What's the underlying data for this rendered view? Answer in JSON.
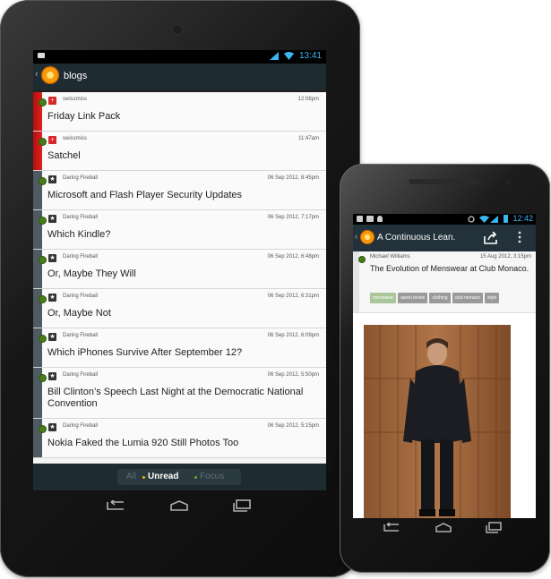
{
  "tablet": {
    "status": {
      "time": "13:41"
    },
    "header": {
      "title": "blogs",
      "back_glyph": "‹"
    },
    "stories": [
      {
        "feed": "swissmiss",
        "date": "12:08pm",
        "title": "Friday Link Pack",
        "feed_icon": "swiss-cross-icon"
      },
      {
        "feed": "swissmiss",
        "date": "11:47am",
        "title": "Satchel",
        "feed_icon": "swiss-cross-icon"
      },
      {
        "feed": "Daring Fireball",
        "date": "06 Sep 2012, 8:45pm",
        "title": "Microsoft and Flash Player Security Updates",
        "feed_icon": "star-icon"
      },
      {
        "feed": "Daring Fireball",
        "date": "06 Sep 2012, 7:17pm",
        "title": "Which Kindle?",
        "feed_icon": "star-icon"
      },
      {
        "feed": "Daring Fireball",
        "date": "06 Sep 2012, 6:48pm",
        "title": "Or, Maybe They Will",
        "feed_icon": "star-icon"
      },
      {
        "feed": "Daring Fireball",
        "date": "06 Sep 2012, 6:31pm",
        "title": "Or, Maybe Not",
        "feed_icon": "star-icon"
      },
      {
        "feed": "Daring Fireball",
        "date": "06 Sep 2012, 6:09pm",
        "title": "Which iPhones Survive After September 12?",
        "feed_icon": "star-icon"
      },
      {
        "feed": "Daring Fireball",
        "date": "06 Sep 2012, 5:50pm",
        "title": "Bill Clinton’s Speech Last Night at the Democratic National Convention",
        "feed_icon": "star-icon"
      },
      {
        "feed": "Daring Fireball",
        "date": "06 Sep 2012, 5:15pm",
        "title": "Nokia Faked the Lumia 920 Still Photos Too",
        "feed_icon": "star-icon"
      }
    ],
    "filter": {
      "all": "All",
      "unread": "Unread",
      "focus": "Focus",
      "selected": "Unread"
    }
  },
  "phone": {
    "status": {
      "time": "12:42"
    },
    "header": {
      "title": "A Continuous Lean.",
      "back_glyph": "‹"
    },
    "story": {
      "author": "Michael Williams",
      "date": "15 Aug 2012, 3:15pm",
      "title": "The Evolution of Menswear at Club Monaco.",
      "tags": [
        "menswear",
        "aaron levine",
        "clothing",
        "club monaco",
        "style"
      ]
    }
  },
  "colors": {
    "accent_blue": "#3ab6f0",
    "unread_green": "#4a7c1a",
    "swissmiss_red": "#d9262c",
    "header_bg": "#1e2b31",
    "unread_yellow": "#f0b400",
    "focus_green": "#6aaa1f"
  }
}
